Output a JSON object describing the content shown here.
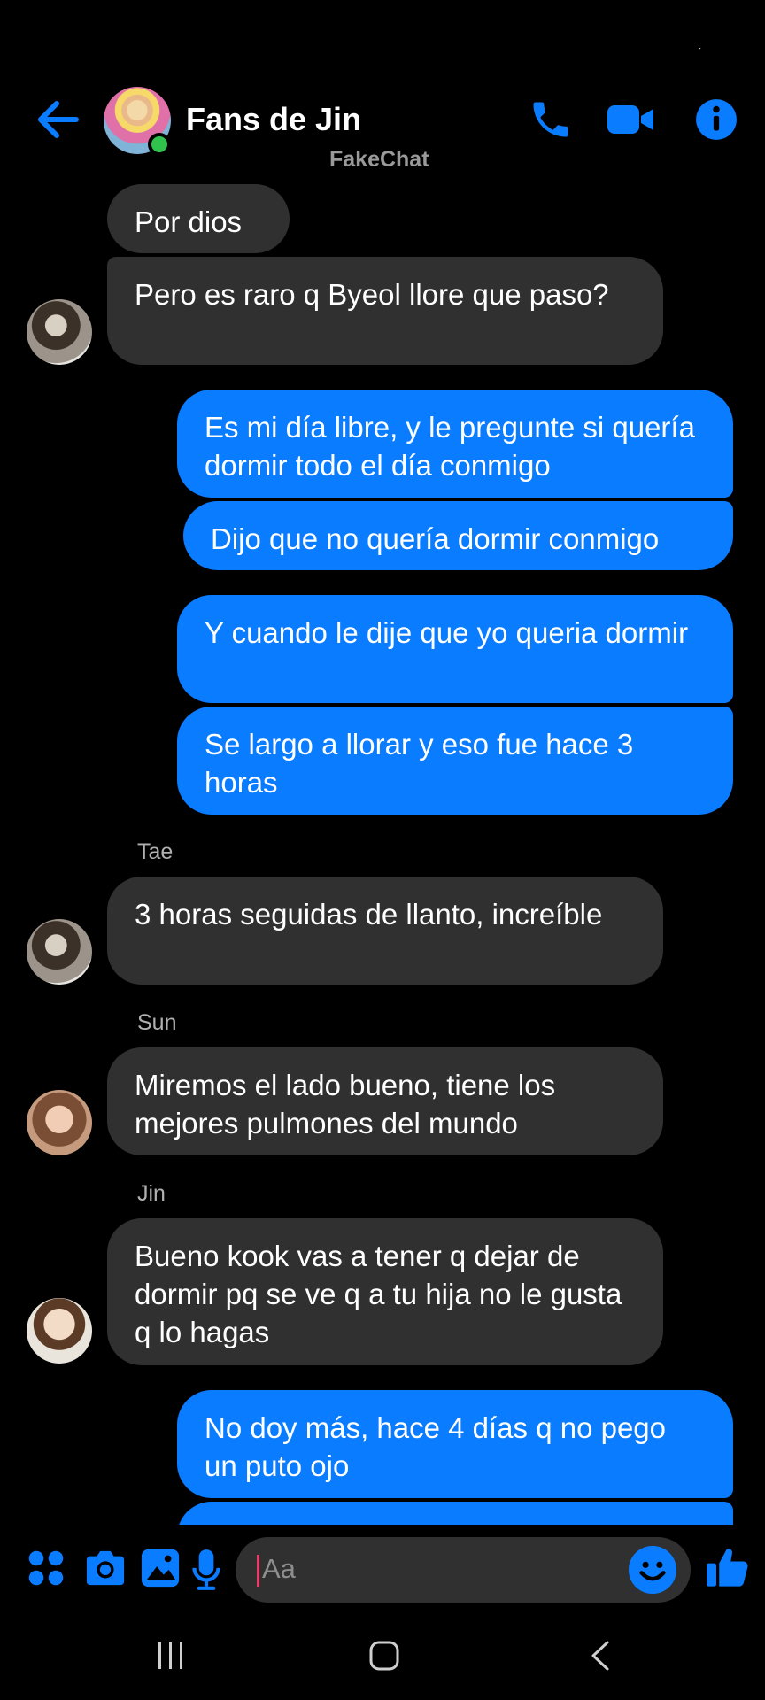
{
  "header": {
    "title": "Fans de Jin",
    "subtitle": "FakeChat",
    "status_mark": "ˏ"
  },
  "messages": [
    {
      "side": "in",
      "text": "Por dios"
    },
    {
      "side": "in",
      "text": "Pero es raro q Byeol llore que paso?"
    },
    {
      "side": "out",
      "text": "Es mi día libre, y le pregunte si quería dormir todo el día conmigo"
    },
    {
      "side": "out",
      "text": "Dijo que no quería dormir conmigo"
    },
    {
      "side": "out",
      "text": "Y cuando le dije que yo queria dormir"
    },
    {
      "side": "out",
      "text": "Se largo a llorar y eso fue hace 3 horas"
    },
    {
      "side": "in",
      "sender": "Tae",
      "text": "3 horas seguidas de llanto, increíble"
    },
    {
      "side": "in",
      "sender": "Sun",
      "text": "Miremos el lado bueno, tiene los mejores pulmones del mundo"
    },
    {
      "side": "in",
      "sender": "Jin",
      "text": "Bueno kook vas a tener q dejar de dormir pq se ve q a tu hija no le gusta q lo hagas"
    },
    {
      "side": "out",
      "text": "No doy más, hace 4 días q no pego un puto ojo"
    }
  ],
  "composer": {
    "placeholder": "Aa"
  },
  "colors": {
    "accent": "#0a7cff",
    "incoming_bubble": "#303030",
    "online": "#31c24d",
    "background": "#000000"
  },
  "icons": [
    "back-arrow-icon",
    "phone-icon",
    "video-camera-icon",
    "info-icon",
    "apps-icon",
    "camera-icon",
    "image-icon",
    "microphone-icon",
    "emoji-icon",
    "thumbs-up-icon",
    "recent-apps-icon",
    "home-icon",
    "back-icon"
  ]
}
